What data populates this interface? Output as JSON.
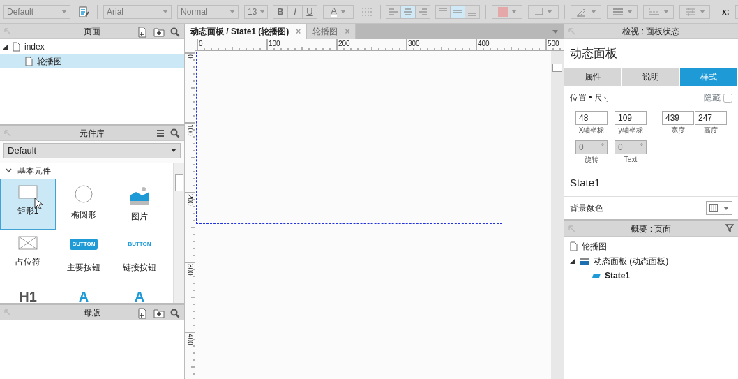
{
  "toolbar": [
    {
      "kind": "select",
      "value": "Default"
    },
    {
      "kind": "icon"
    },
    {
      "kind": "sep"
    },
    {
      "kind": "select",
      "value": "Arial"
    },
    {
      "kind": "select",
      "value": "Normal"
    },
    {
      "kind": "select",
      "value": "13"
    },
    {
      "kind": "group",
      "disabled": true,
      "buttons": [
        {
          "text": "B"
        },
        {
          "text": "I"
        },
        {
          "text": "U"
        }
      ]
    },
    {
      "kind": "dropdown",
      "text": "A"
    },
    {
      "kind": "icon"
    },
    {
      "kind": "sep"
    },
    {
      "kind": "group",
      "buttons": [
        {
          "selected": false
        },
        {
          "selected": true
        },
        {
          "selected": false
        }
      ]
    },
    {
      "kind": "group",
      "buttons": [
        {
          "selected": false
        },
        {
          "selected": true
        },
        {
          "selected": false
        }
      ]
    },
    {
      "kind": "sep"
    },
    {
      "kind": "color",
      "color": "#e4a8a8"
    },
    {
      "kind": "dropdown"
    },
    {
      "kind": "sep"
    },
    {
      "kind": "dropdown"
    },
    {
      "kind": "dropdown"
    },
    {
      "kind": "dropdown"
    },
    {
      "kind": "dropdown"
    },
    {
      "kind": "sep"
    },
    {
      "kind": "label",
      "text": "x:"
    },
    {
      "kind": "field"
    }
  ],
  "pages": {
    "title": "页面",
    "tree": [
      {
        "label": "index",
        "expanded": true,
        "selected": false,
        "children": [
          {
            "label": "轮播图",
            "selected": true
          }
        ]
      }
    ]
  },
  "library": {
    "title": "元件库",
    "dropdown": "Default",
    "category": "基本元件",
    "category_expanded": true,
    "widgets": [
      {
        "label": "矩形1",
        "kind": "rect",
        "selected": true
      },
      {
        "label": "椭圆形",
        "kind": "ellipse",
        "selected": false
      },
      {
        "label": "图片",
        "kind": "image",
        "selected": false
      },
      {
        "label": "占位符",
        "kind": "placeholder",
        "selected": false
      },
      {
        "label": "主要按钮",
        "kind": "primary",
        "glyph": "BUTTON",
        "selected": false
      },
      {
        "label": "链接按钮",
        "kind": "link",
        "glyph": "BUTTON",
        "selected": false
      },
      {
        "kind": "heading",
        "glyph": "H1",
        "selected": false
      },
      {
        "kind": "label",
        "glyph": "A",
        "selected": false
      },
      {
        "kind": "paragraph",
        "glyph": "A",
        "selected": false
      }
    ]
  },
  "masters": {
    "title": "母版"
  },
  "tabs": [
    {
      "label": "动态面板 / State1 (轮播图)",
      "close": "×",
      "selected": true
    },
    {
      "label": "轮播图",
      "close": "×",
      "selected": false
    }
  ],
  "ruler": {
    "x_labels": [
      "0",
      "100",
      "200",
      "300",
      "400",
      "500"
    ],
    "y_labels": [
      "0",
      "100",
      "200",
      "300",
      "400"
    ]
  },
  "inspector": {
    "header": "检视 : 面板状态",
    "title": "动态面板",
    "tabs": [
      {
        "label": "属性",
        "selected": false
      },
      {
        "label": "说明",
        "selected": false
      },
      {
        "label": "样式",
        "selected": true
      }
    ],
    "section": "位置 • 尺寸",
    "hidden_label": "隐藏",
    "hidden_checked": false,
    "fields": [
      {
        "value": "48",
        "label": "X轴坐标"
      },
      {
        "value": "109",
        "label": "y轴坐标"
      },
      {
        "value": "439",
        "label": "宽度"
      },
      {
        "value": "247",
        "label": "高度"
      }
    ],
    "fields2": [
      {
        "value": "0",
        "unit": "°",
        "label": "旋转",
        "disabled": true
      },
      {
        "value": "0",
        "unit": "°",
        "label": "Text",
        "disabled": true
      }
    ],
    "state_name": "State1",
    "bg_label": "背景颜色"
  },
  "outline": {
    "title": "概要 : 页面",
    "tree": [
      {
        "label": "轮播图",
        "kind": "page",
        "bold": false
      },
      {
        "label": "动态面板 (动态面板)",
        "kind": "panel",
        "bold": false,
        "expanded": true,
        "children": [
          {
            "label": "State1",
            "kind": "state",
            "bold": true
          }
        ]
      }
    ]
  }
}
